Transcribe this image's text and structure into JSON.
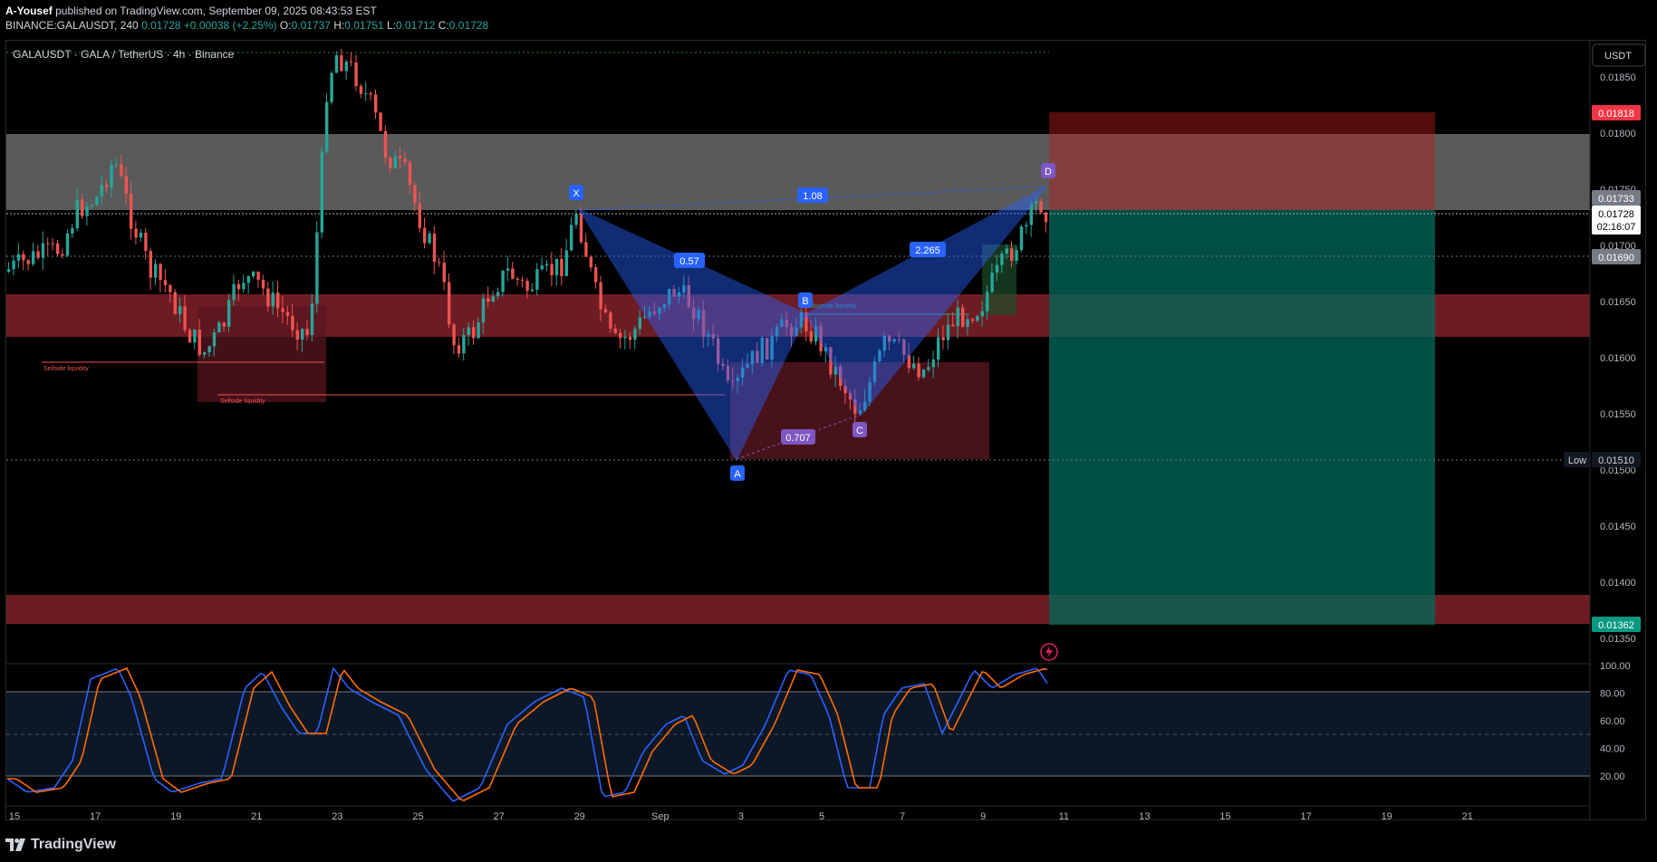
{
  "header": {
    "publisher": "A-Yousef",
    "published_text": "published on TradingView.com, September 09, 2025 08:43:53 EST",
    "symbol_line": "BINANCE:GALAUSDT, 240",
    "last": "0.01728",
    "change": "+0.00038 (+2.25%)",
    "open_label": "O:",
    "open": "0.01737",
    "high_label": "H:",
    "high": "0.01751",
    "low_label": "L:",
    "low": "0.01712",
    "close_label": "C:",
    "close": "0.01728"
  },
  "chart": {
    "legend": "GALAUSDT · GALA / TetherUS · 4h · Binance",
    "currency_button": "USDT",
    "price_ticks": [
      "0.01850",
      "0.01800",
      "0.01750",
      "0.01700",
      "0.01650",
      "0.01600",
      "0.01550",
      "0.01500",
      "0.01450",
      "0.01400",
      "0.01350"
    ],
    "price_tags": {
      "stop": "0.01818",
      "entry": "0.01733",
      "last": "0.01728",
      "countdown": "02:16:07",
      "level": "0.01690",
      "low_label": "Low",
      "low": "0.01510",
      "target": "0.01362"
    },
    "time_ticks": [
      "15",
      "17",
      "19",
      "21",
      "23",
      "25",
      "27",
      "29",
      "Sep",
      "3",
      "5",
      "7",
      "9",
      "11",
      "13",
      "15",
      "17",
      "19",
      "21"
    ],
    "pattern": {
      "points": [
        "X",
        "A",
        "B",
        "C",
        "D"
      ],
      "ratios": [
        "1.08",
        "0.57",
        "2.265",
        "0.707"
      ]
    },
    "liquidity_labels": [
      "Sellside liquidity",
      "Sellside liquidity",
      "Buyside liquidity"
    ],
    "colors": {
      "up": "#26a69a",
      "down": "#ef5350",
      "pattern": "#2962ff",
      "pattern_c": "#7e57c2",
      "profit": "#00695c",
      "loss": "#b71c1c"
    }
  },
  "stoch": {
    "ticks": [
      "100.00",
      "80.00",
      "60.00",
      "40.00",
      "20.00"
    ],
    "k_color": "#2962ff",
    "d_color": "#ff6d00"
  },
  "footer": {
    "brand": "TradingView"
  }
}
